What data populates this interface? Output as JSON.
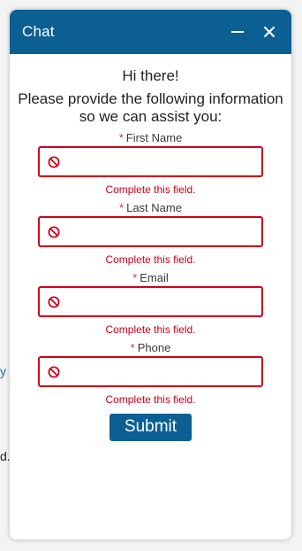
{
  "background": {
    "fragment_link": "y",
    "fragment_text": "d."
  },
  "header": {
    "title": "Chat",
    "minimize_icon": "minimize-icon",
    "close_icon": "close-icon",
    "color": "#0b5f93"
  },
  "form": {
    "greeting": "Hi there!",
    "intro": "Please provide the following information so we can assist you:",
    "required_marker": "*",
    "error_color": "#d0021b",
    "fields": [
      {
        "label": "First Name",
        "value": "",
        "error": "Complete this field."
      },
      {
        "label": "Last Name",
        "value": "",
        "error": "Complete this field."
      },
      {
        "label": "Email",
        "value": "",
        "error": "Complete this field."
      },
      {
        "label": "Phone",
        "value": "",
        "error": "Complete this field."
      }
    ],
    "submit_label": "Submit"
  }
}
